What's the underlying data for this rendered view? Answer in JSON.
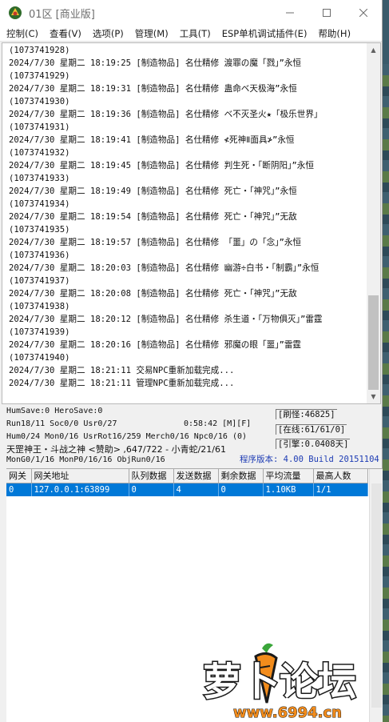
{
  "window": {
    "title": "01区 [商业版]"
  },
  "menu": [
    {
      "label": "控制(C)"
    },
    {
      "label": "查看(V)"
    },
    {
      "label": "选项(P)"
    },
    {
      "label": "管理(M)"
    },
    {
      "label": "工具(T)"
    },
    {
      "label": "ESP单机调试插件(E)"
    },
    {
      "label": "帮助(H)"
    }
  ],
  "log": [
    "(1073741928)",
    "2024/7/30 星期二 18:19:25 [制造物品] 名仕精修 渡罪の魔「戮」”永恒",
    "(1073741929)",
    "2024/7/30 星期二 18:19:31 [制造物品] 名仕精修 蛊命ベ天极海”永恒",
    "(1073741930)",
    "2024/7/30 星期二 18:19:36 [制造物品] 名仕精修 ベ不灭圣火★「极乐世界」",
    "(1073741931)",
    "2024/7/30 星期二 18:19:41 [制造物品] 名仕精修 ≮死神Ⅱ面具≯”永恒",
    "(1073741932)",
    "2024/7/30 星期二 18:19:45 [制造物品] 名仕精修 判生死・「断阴阳」”永恒",
    "(1073741933)",
    "2024/7/30 星期二 18:19:49 [制造物品] 名仕精修 死亡・「神咒」”永恒",
    "(1073741934)",
    "2024/7/30 星期二 18:19:54 [制造物品] 名仕精修 死亡・「神咒」”无敌",
    "(1073741935)",
    "2024/7/30 星期二 18:19:57 [制造物品] 名仕精修 「噩」の「念」”永恒",
    "(1073741936)",
    "2024/7/30 星期二 18:20:03 [制造物品] 名仕精修 幽游÷白书・「制霸」”永恒",
    "(1073741937)",
    "2024/7/30 星期二 18:20:08 [制造物品] 名仕精修 死亡・「神咒」”无敌",
    "(1073741938)",
    "2024/7/30 星期二 18:20:12 [制造物品] 名仕精修 杀生道・「万物俱灭」”雷霆",
    "(1073741939)",
    "2024/7/30 星期二 18:20:16 [制造物品] 名仕精修 邪魔の眼「噩」”雷霆",
    "(1073741940)",
    "2024/7/30 星期二 18:21:11 交易NPC重新加载完成...",
    "2024/7/30 星期二 18:21:11 管理NPC重新加载完成..."
  ],
  "status": {
    "line1": "HumSave:0 HeroSave:0",
    "line2": "Run18/11 Soc0/0 Usr0/27",
    "time": "0:58:42 [M][F]",
    "line3": "Hum0/24 Mon0/16 UsrRot16/259 Merch0/16 Npc0/16 (0)",
    "line4": "天罡神王・斗战之神 <赞助> ,647/722 - 小青蛇/21/61",
    "line5": "MonG0/1/16 MonP0/16/16 ObjRun0/16",
    "refresh": "[刷怪:46825]",
    "online": "[在线:61/61/0]",
    "engine": "[引擎:0.0408天]",
    "version": "程序版本: 4.00 Build 20151104"
  },
  "grid": {
    "headers": [
      "网关",
      "网关地址",
      "队列数据",
      "发送数据",
      "剩余数据",
      "平均流量",
      "最高人数"
    ],
    "rows": [
      [
        "0",
        "127.0.0.1:63899",
        "0",
        "4",
        "0",
        "1.10KB",
        "1/1"
      ]
    ]
  },
  "watermark": {
    "brand": "萝卜论坛",
    "url": "www.6994.cn"
  },
  "colors": {
    "selection": "#0078d7",
    "version_text": "#1e3cb4",
    "watermark_orange": "#f28c1c"
  }
}
